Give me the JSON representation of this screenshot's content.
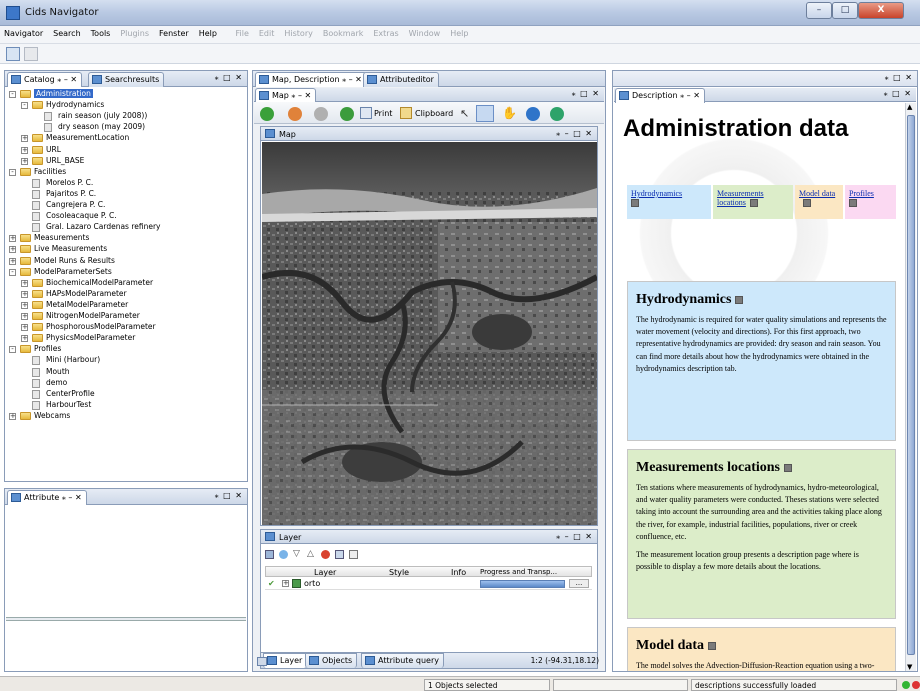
{
  "window": {
    "title": "Cids Navigator",
    "controls": [
      "–",
      "□",
      "X"
    ]
  },
  "menus": {
    "active": [
      "Navigator",
      "Search",
      "Tools",
      "Plugins",
      "Fenster",
      "Help"
    ],
    "disabled": [
      "File",
      "Edit",
      "History",
      "Bookmark",
      "Extras",
      "Window",
      "Help"
    ]
  },
  "left_panel": {
    "tabs": [
      "Catalog",
      "Searchresults"
    ],
    "tree": [
      {
        "label": "Administration",
        "level": 0,
        "kind": "folder",
        "exp": "-",
        "selected": true
      },
      {
        "label": "Hydrodynamics",
        "level": 1,
        "kind": "folder",
        "exp": "-"
      },
      {
        "label": "rain season (july 2008))",
        "level": 2,
        "kind": "leaf"
      },
      {
        "label": "dry season (may 2009)",
        "level": 2,
        "kind": "leaf"
      },
      {
        "label": "MeasurementLocation",
        "level": 1,
        "kind": "folder",
        "exp": "+"
      },
      {
        "label": "URL",
        "level": 1,
        "kind": "folder",
        "exp": "+"
      },
      {
        "label": "URL_BASE",
        "level": 1,
        "kind": "folder",
        "exp": "+"
      },
      {
        "label": "Facilities",
        "level": 0,
        "kind": "folder",
        "exp": "-"
      },
      {
        "label": "Morelos P. C.",
        "level": 1,
        "kind": "leaf"
      },
      {
        "label": "Pajaritos P. C.",
        "level": 1,
        "kind": "leaf"
      },
      {
        "label": "Cangrejera P. C.",
        "level": 1,
        "kind": "leaf"
      },
      {
        "label": "Cosoleacaque P. C.",
        "level": 1,
        "kind": "leaf"
      },
      {
        "label": "Gral. Lazaro Cardenas refinery",
        "level": 1,
        "kind": "leaf"
      },
      {
        "label": "Measurements",
        "level": 0,
        "kind": "folder",
        "exp": "+"
      },
      {
        "label": "Live Measurements",
        "level": 0,
        "kind": "folder",
        "exp": "+"
      },
      {
        "label": "Model Runs & Results",
        "level": 0,
        "kind": "folder",
        "exp": "+"
      },
      {
        "label": "ModelParameterSets",
        "level": 0,
        "kind": "folder",
        "exp": "-"
      },
      {
        "label": "BiochemicalModelParameter",
        "level": 1,
        "kind": "folder",
        "exp": "+"
      },
      {
        "label": "HAPsModelParameter",
        "level": 1,
        "kind": "folder",
        "exp": "+"
      },
      {
        "label": "MetalModelParameter",
        "level": 1,
        "kind": "folder",
        "exp": "+"
      },
      {
        "label": "NitrogenModelParameter",
        "level": 1,
        "kind": "folder",
        "exp": "+"
      },
      {
        "label": "PhosphorousModelParameter",
        "level": 1,
        "kind": "folder",
        "exp": "+"
      },
      {
        "label": "PhysicsModelParameter",
        "level": 1,
        "kind": "folder",
        "exp": "+"
      },
      {
        "label": "Profiles",
        "level": 0,
        "kind": "folder",
        "exp": "-"
      },
      {
        "label": "Mini (Harbour)",
        "level": 1,
        "kind": "leaf"
      },
      {
        "label": "Mouth",
        "level": 1,
        "kind": "leaf"
      },
      {
        "label": "demo",
        "level": 1,
        "kind": "leaf"
      },
      {
        "label": "CenterProfile",
        "level": 1,
        "kind": "leaf"
      },
      {
        "label": "HarbourTest",
        "level": 1,
        "kind": "leaf"
      },
      {
        "label": "Webcams",
        "level": 0,
        "kind": "folder",
        "exp": "+"
      }
    ]
  },
  "attribute_panel": {
    "tab": "Attribute"
  },
  "center_panel": {
    "tabs": [
      "Map, Description",
      "Attributeditor"
    ],
    "inner_tab": "Map",
    "toolbar": {
      "print": "Print",
      "clipboard": "Clipboard"
    },
    "map_title": "Map",
    "layer_panel": {
      "title": "Layer",
      "columns": [
        "Layer",
        "Style",
        "Info",
        "Progress and Transp..."
      ],
      "rows": [
        {
          "name": "orto",
          "progress": 1.0
        }
      ],
      "bottom_tabs": [
        "Layer",
        "Objects",
        "Attribute query"
      ],
      "coords": "1:2 (-94.31,18.12)"
    }
  },
  "description": {
    "tab": "Description",
    "title": "Administration data",
    "nav": [
      "Hydrodynamics",
      "Measurements locations",
      "Model data",
      "Profiles"
    ],
    "nav_colors": [
      "#cde8fb",
      "#dcedc9",
      "#fbe7c3",
      "#fbd9f2"
    ],
    "sections": [
      {
        "title": "Hydrodynamics",
        "color": "#cde8fb",
        "paragraphs": [
          "The hydrodynamic is required for water quality simulations and represents the water movement (velocity and directions). For this first approach, two representative hydrodynamics are provided: dry season and rain season. You can find more details about how the hydrodynamics were obtained in the hydrodynamics description tab."
        ]
      },
      {
        "title": "Measurements locations",
        "color": "#dcedc9",
        "paragraphs": [
          "Ten stations where measurements of hydrodynamics, hydro-meteorological, and water quality parameters were conducted. Theses stations were selected taking into account the surrounding area and the activities taking place along the river, for example, industrial facilities, populations, river or creek confluence, etc.",
          "The measurement location group presents a description page where is possible to display a few more details about the locations."
        ]
      },
      {
        "title": "Model data",
        "color": "#fbe7c3",
        "paragraphs": [
          "The model solves the Advection-Diffusion-Reaction equation using a two-dimensional approach to transport the pollutants, and it includes the following 6 principal"
        ]
      }
    ]
  },
  "statusbar": {
    "objects": "1 Objects selected",
    "message": "descriptions successfully loaded"
  }
}
